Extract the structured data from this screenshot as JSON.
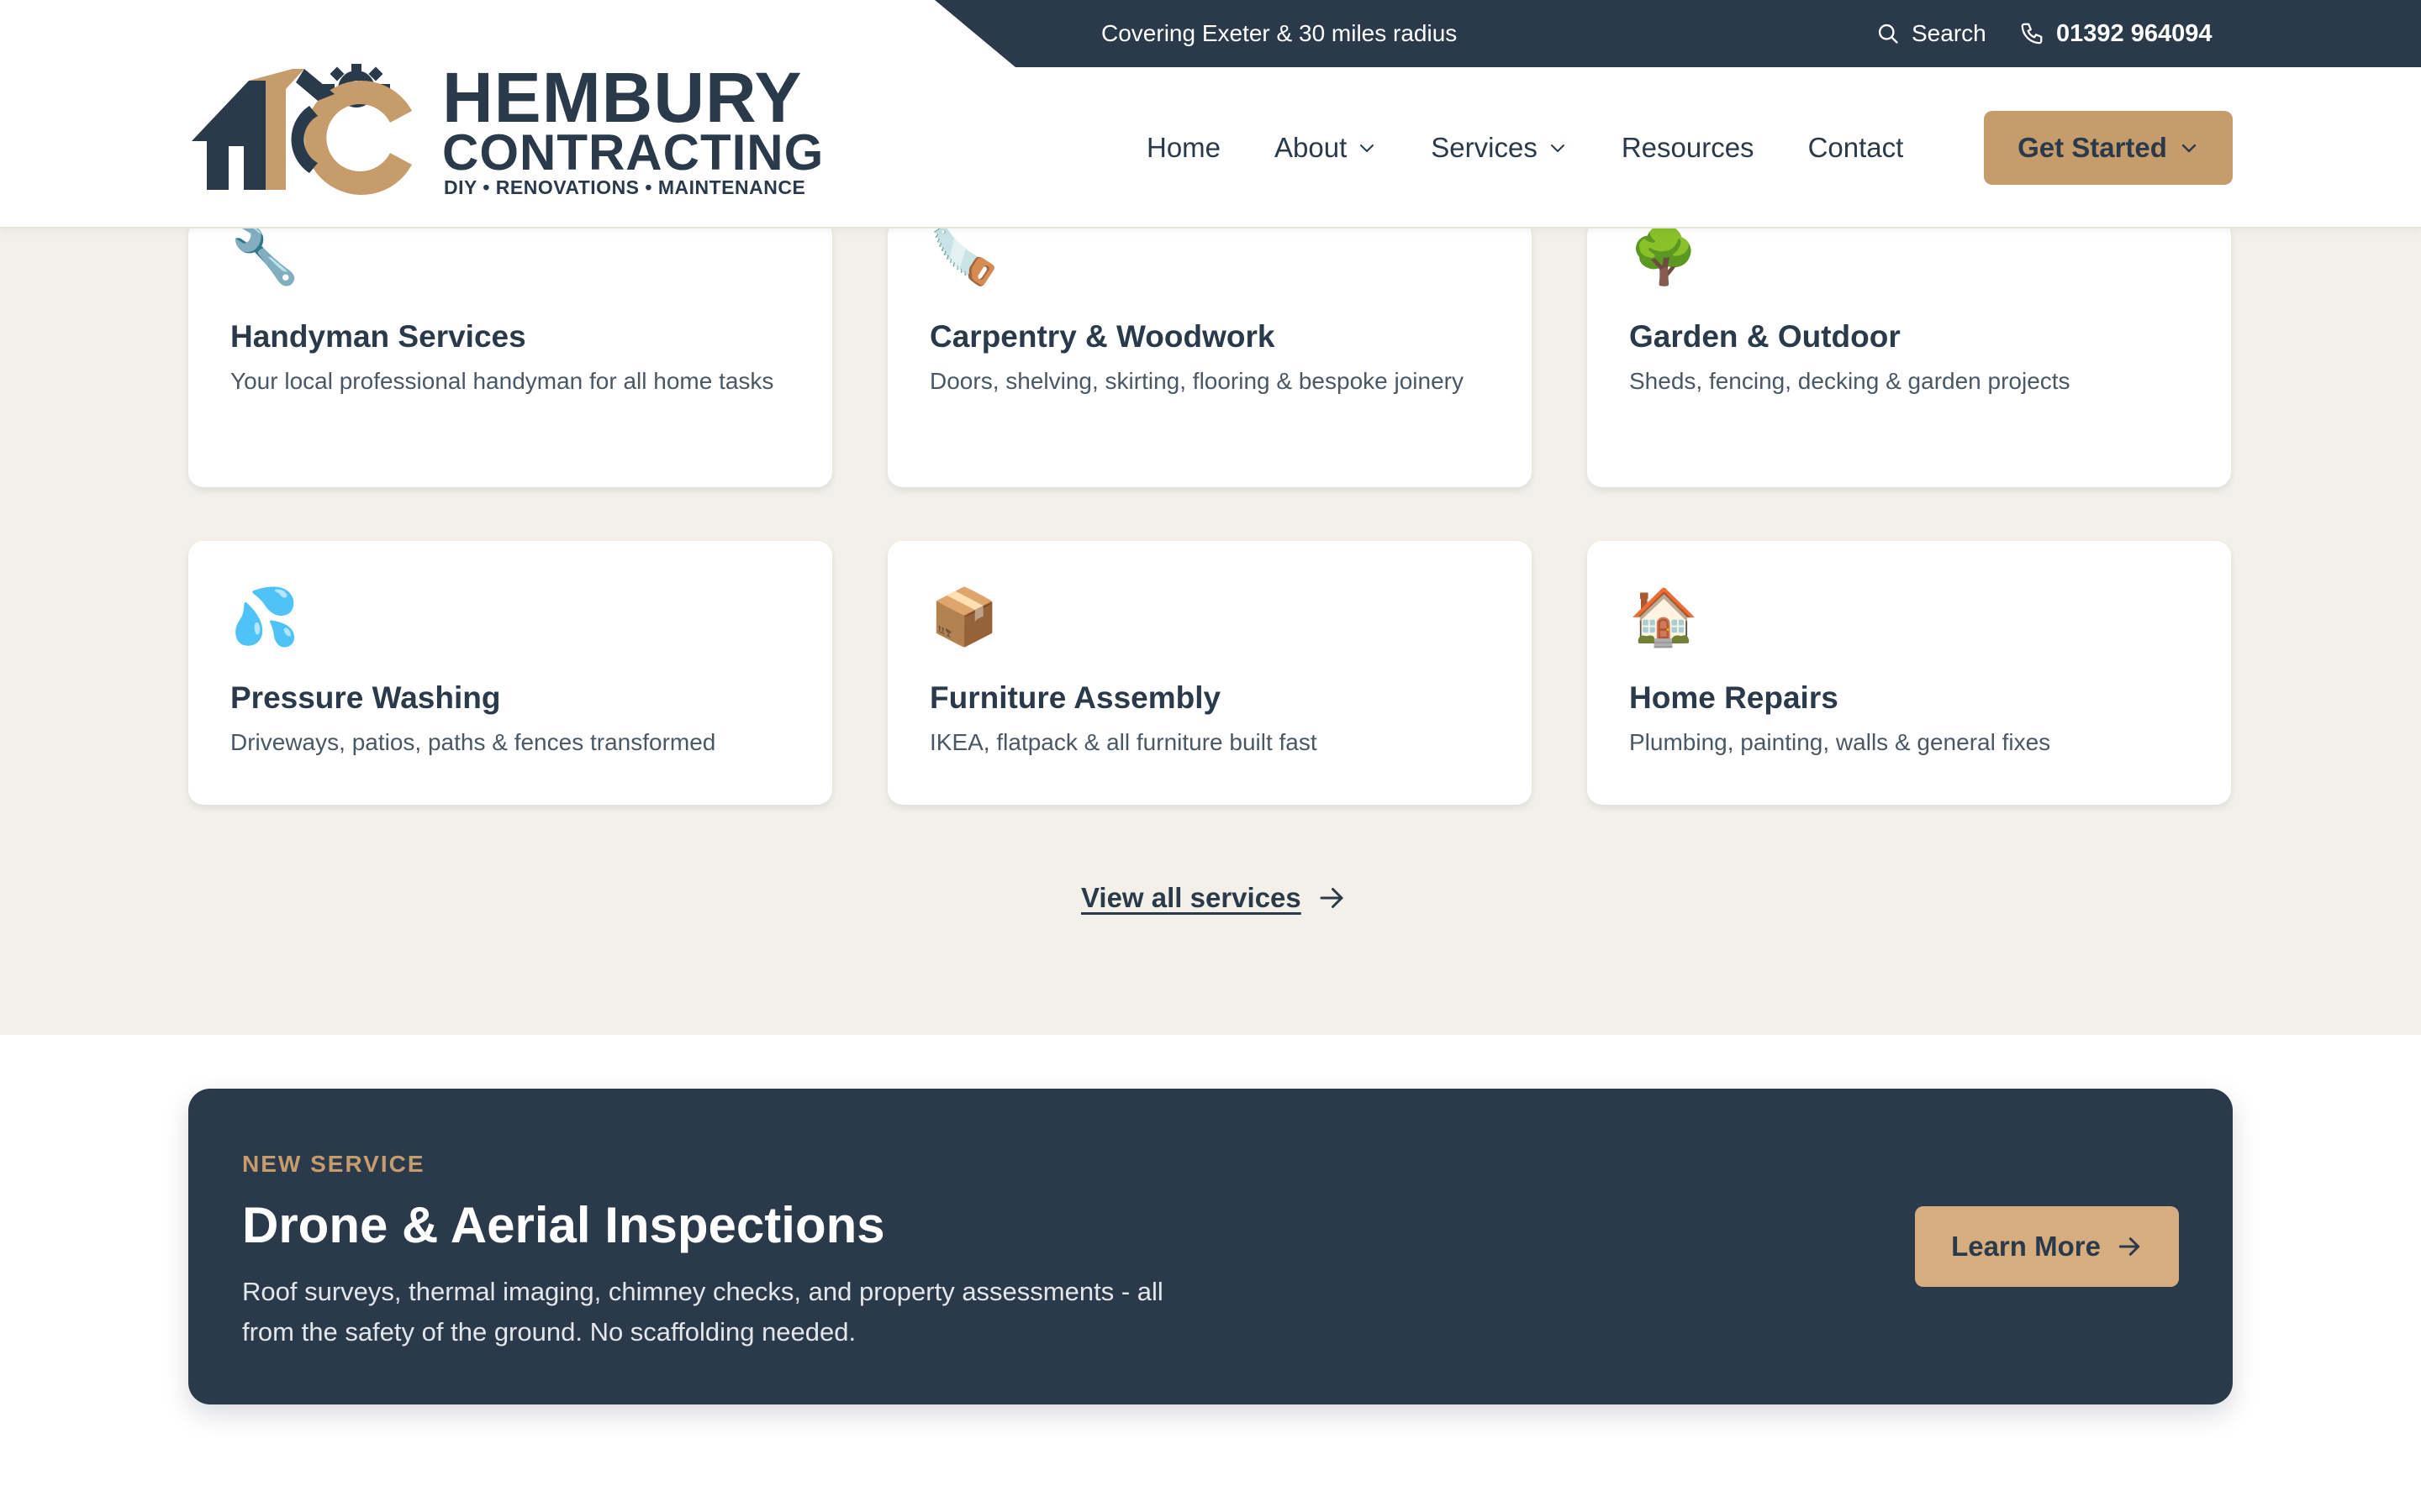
{
  "topbar": {
    "coverage": "Covering Exeter & 30 miles radius",
    "search_label": "Search",
    "phone": "01392 964094"
  },
  "logo": {
    "name": "HEMBURY",
    "subname": "CONTRACTING",
    "tagline": "DIY • RENOVATIONS • MAINTENANCE"
  },
  "nav": {
    "items": [
      {
        "label": "Home"
      },
      {
        "label": "About"
      },
      {
        "label": "Services"
      },
      {
        "label": "Resources"
      },
      {
        "label": "Contact"
      }
    ],
    "cta": "Get Started"
  },
  "services": {
    "cards": [
      {
        "icon": "🔧",
        "title": "Handyman Services",
        "desc": "Your local professional handyman for all home tasks"
      },
      {
        "icon": "🪚",
        "title": "Carpentry & Woodwork",
        "desc": "Doors, shelving, skirting, flooring & bespoke joinery"
      },
      {
        "icon": "🌳",
        "title": "Garden & Outdoor",
        "desc": "Sheds, fencing, decking & garden projects"
      },
      {
        "icon": "💦",
        "title": "Pressure Washing",
        "desc": "Driveways, patios, paths & fences transformed"
      },
      {
        "icon": "📦",
        "title": "Furniture Assembly",
        "desc": "IKEA, flatpack & all furniture built fast"
      },
      {
        "icon": "🏠",
        "title": "Home Repairs",
        "desc": "Plumbing, painting, walls & general fixes"
      }
    ],
    "view_all": "View all services"
  },
  "banner": {
    "eyebrow": "NEW SERVICE",
    "title": "Drone & Aerial Inspections",
    "desc": "Roof surveys, thermal imaging, chimney checks, and property assessments - all from the safety of the ground. No scaffolding needed.",
    "button": "Learn More"
  },
  "colors": {
    "navy": "#2b3a4a",
    "accent": "#c69c6d",
    "section_bg": "#f3f0e9"
  }
}
